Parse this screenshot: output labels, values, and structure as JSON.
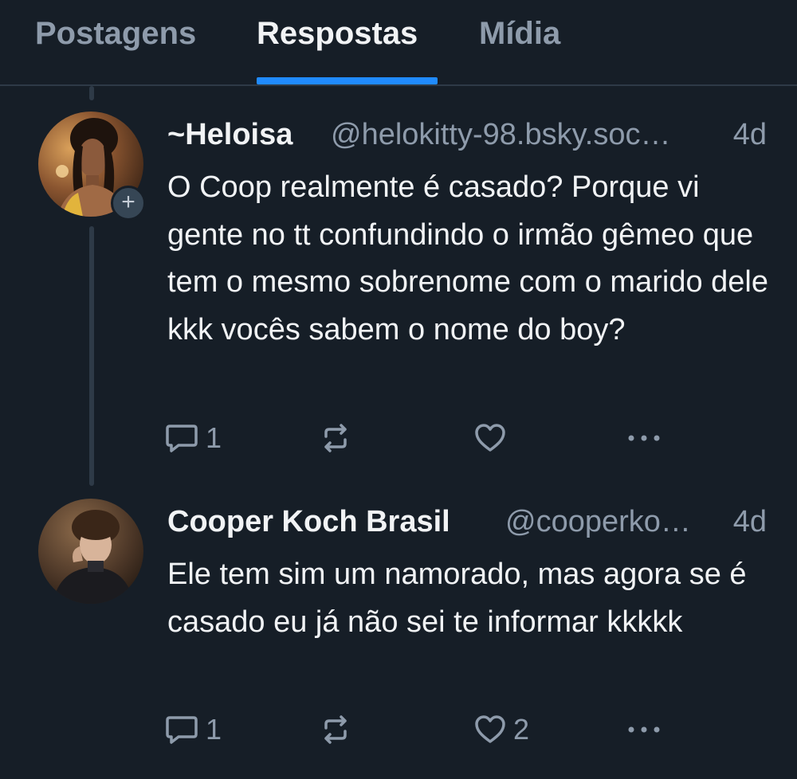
{
  "tabs": [
    {
      "label": "Postagens",
      "active": false
    },
    {
      "label": "Respostas",
      "active": true
    },
    {
      "label": "Mídia",
      "active": false
    }
  ],
  "colors": {
    "background": "#161e27",
    "accent": "#208bfe",
    "muted_text": "#8e9bab",
    "thread_line": "#2e3a47"
  },
  "posts": [
    {
      "display_name": "~Heloisa",
      "handle": "@helokitty-98.bsky.soc…",
      "time": "4d",
      "text": "O Coop realmente é casado? Porque vi gente no tt confundindo o irmão gêmeo que tem o mesmo sobrenome com o marido dele kkk vocês sabem o nome do boy?",
      "reply_count": "1",
      "repost_count": "",
      "like_count": "",
      "follow_badge": "+"
    },
    {
      "display_name": "Cooper Koch Brasil",
      "handle": "@cooperko…",
      "time": "4d",
      "text": "Ele tem sim um namorado, mas agora se é casado eu já não sei te informar kkkkk",
      "reply_count": "1",
      "repost_count": "",
      "like_count": "2"
    }
  ],
  "icons": {
    "reply": "speech-bubble-icon",
    "repost": "repost-arrows-icon",
    "like": "heart-icon",
    "more": "ellipsis-icon"
  }
}
